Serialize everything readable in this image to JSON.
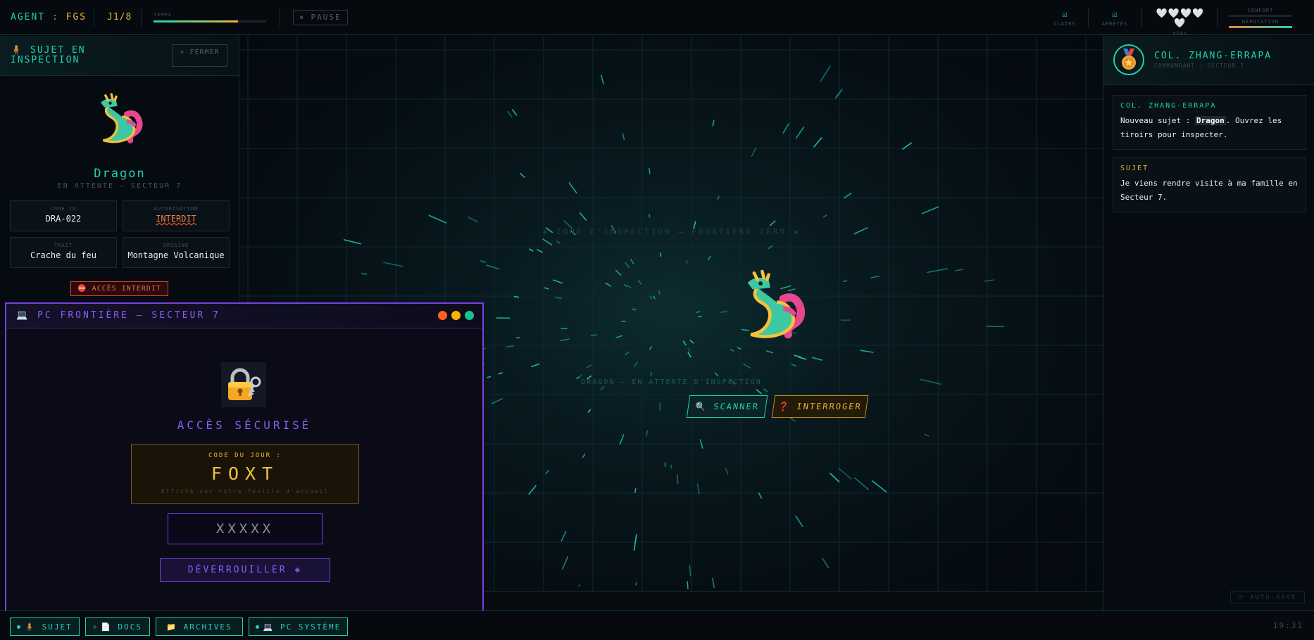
{
  "topbar": {
    "agent_prefix": "AGENT : ",
    "agent_id": "FGS",
    "day": "J1/8",
    "time_label": "TEMPS",
    "time_progress": 0.75,
    "pause_label": "⏸ PAUSE",
    "stats": [
      {
        "icon": "check-box-icon",
        "symbol": "☑",
        "label": "CLAIRS"
      },
      {
        "icon": "check-box-icon",
        "symbol": "☑",
        "label": "ARRÊTÉS"
      }
    ],
    "lives_symbols": "🤍🤍🤍🤍🤍",
    "lives_label": "VIES",
    "lives_count": 5,
    "comfort_label": "CONFORT",
    "comfort_value": 0,
    "reputation_label": "RÉPUTATION",
    "reputation_value": 1.0
  },
  "subject_panel": {
    "title": "🧍 SUJET EN INSPECTION",
    "close_label": "✕ FERMER",
    "avatar": "dragon",
    "name": "Dragon",
    "status": "EN ATTENTE — SECTEUR 7",
    "fields": [
      {
        "key": "CODE ID",
        "value": "DRA-022",
        "alert": false
      },
      {
        "key": "AUTORISATION",
        "value": "INTERDIT",
        "alert": true
      },
      {
        "key": "TRAIT",
        "value": "Crache du feu",
        "alert": false
      },
      {
        "key": "ORIGINE",
        "value": "Montagne Volcanique",
        "alert": false
      }
    ],
    "access_badge": "⛔ ACCÈS INTERDIT"
  },
  "pc_window": {
    "title": "💻 PC FRONTIÈRE — SECTEUR 7",
    "window_dot_colors": [
      "#ff5f1f",
      "#f5b400",
      "#18c28a"
    ],
    "lock_icon": "lock-with-key-icon",
    "secure_label": "ACCÈS SÉCURISÉ",
    "code_label": "CODE DU JOUR :",
    "code_value": "FOXT",
    "code_note": "Affiché sur votre feuille d'accueil",
    "input_placeholder": "XXXXX",
    "unlock_label": "DÉVERROUILLER ◈"
  },
  "stage": {
    "zone_title": "◈ ZONE D'INSPECTION — FRONTIÈRE ZÉRO ◈",
    "avatar": "dragon",
    "status": "DRAGON — EN ATTENTE D'INSPECTION",
    "scan_label": "🔍 SCANNER",
    "ask_label": "❓ INTERROGER"
  },
  "right_panel": {
    "commander_name": "COL. ZHANG-ERRAPA",
    "commander_role": "COMMANDANT — SECTEUR 7",
    "medal_icon": "medal-icon",
    "messages": [
      {
        "from": "COL. ZHANG-ERRAPA",
        "pre": "Nouveau sujet : ",
        "bold": "Dragon",
        "post": ". Ouvrez les tiroirs pour inspecter."
      },
      {
        "from": "SUJET",
        "pre": "Je viens rendre visite à ma famille en Secteur 7.",
        "bold": "",
        "post": ""
      }
    ],
    "autosave": "⟳ AUTO-SAVE"
  },
  "dock": {
    "items": [
      {
        "label": "🧍 SUJET",
        "active": true
      },
      {
        "label": "📄 DOCS",
        "active": false
      },
      {
        "label": "📁 ARCHIVES",
        "active": false
      },
      {
        "label": "💻 PC SYSTÈME",
        "active": true
      }
    ],
    "clock": "19:31"
  },
  "colors": {
    "accent": "#1fd1b3",
    "gold": "#e6b437",
    "purple": "#8b5cf6",
    "danger": "#f0813a"
  }
}
